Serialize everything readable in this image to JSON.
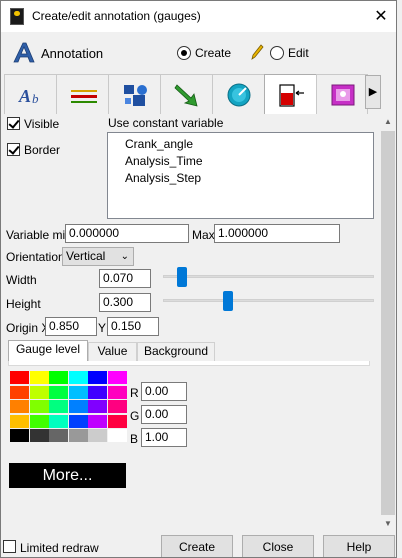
{
  "window": {
    "title": "Create/edit annotation (gauges)"
  },
  "toolbar": {
    "annotation_label": "Annotation",
    "create_label": "Create",
    "edit_label": "Edit",
    "mode": "Create"
  },
  "type_tabs": [
    {
      "name": "text",
      "icon": "text-annotation-icon"
    },
    {
      "name": "lines",
      "icon": "lines-icon"
    },
    {
      "name": "shapes",
      "icon": "shapes-icon"
    },
    {
      "name": "arrows",
      "icon": "arrow-icon"
    },
    {
      "name": "dials",
      "icon": "dial-icon"
    },
    {
      "name": "gauges",
      "icon": "gauge-icon",
      "active": true
    },
    {
      "name": "legend",
      "icon": "image-icon"
    }
  ],
  "options": {
    "visible_label": "Visible",
    "visible_checked": true,
    "border_label": "Border",
    "border_checked": true,
    "constant_var_label": "Use constant variable",
    "constant_vars": [
      "Crank_angle",
      "Analysis_Time",
      "Analysis_Step"
    ]
  },
  "fields": {
    "var_min_label": "Variable min",
    "var_min_value": "0.000000",
    "max_label": "Max",
    "max_value": "1.000000",
    "orientation_label": "Orientation",
    "orientation_value": "Vertical",
    "width_label": "Width",
    "width_value": "0.070",
    "width_slider_fraction": 0.07,
    "height_label": "Height",
    "height_value": "0.300",
    "height_slider_fraction": 0.3,
    "origin_x_label": "Origin X",
    "origin_x_value": "0.850",
    "origin_y_label": "Y",
    "origin_y_value": "0.150"
  },
  "color_tabs": {
    "gauge_level": "Gauge level",
    "value": "Value",
    "background": "Background",
    "active": "Gauge level"
  },
  "color_values": {
    "r_label": "R",
    "r_value": "0.00",
    "g_label": "G",
    "g_value": "0.00",
    "b_label": "B",
    "b_value": "1.00",
    "more_label": "More..."
  },
  "palette": [
    [
      "#ff0000",
      "#ffff00",
      "#00ff00",
      "#00ffff",
      "#0000ff",
      "#ff00ff"
    ],
    [
      "#ff4000",
      "#bfff00",
      "#00ff40",
      "#00bfff",
      "#4000ff",
      "#ff00bf"
    ],
    [
      "#ff8000",
      "#80ff00",
      "#00ff80",
      "#0080ff",
      "#8000ff",
      "#ff0080"
    ],
    [
      "#ffbf00",
      "#40ff00",
      "#00ffbf",
      "#0040ff",
      "#bf00ff",
      "#ff0040"
    ],
    [
      "#000000",
      "#333333",
      "#666666",
      "#999999",
      "#cccccc",
      "#ffffff"
    ]
  ],
  "footer": {
    "limited_redraw_label": "Limited redraw",
    "limited_redraw_checked": false,
    "create_button": "Create",
    "close_button": "Close",
    "help_button": "Help"
  }
}
